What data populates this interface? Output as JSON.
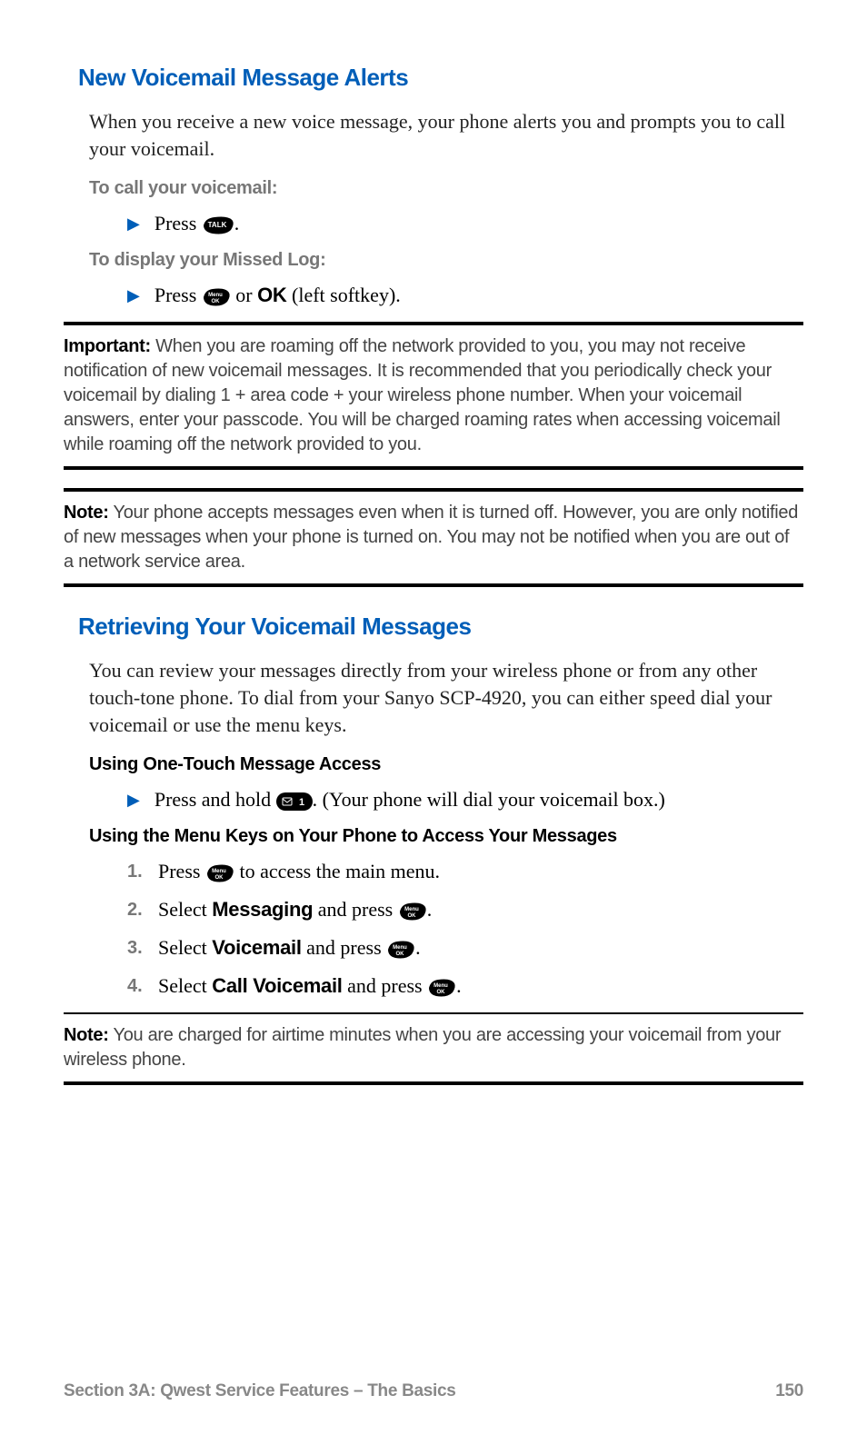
{
  "section1": {
    "heading": "New Voicemail Message Alerts",
    "intro": "When you receive a new voice message, your phone alerts you and prompts you to call your voicemail.",
    "instr1_label": "To call your voicemail:",
    "instr1_step_pre": "Press ",
    "instr1_step_post": ".",
    "instr2_label": "To display your Missed Log:",
    "instr2_step_pre": "Press ",
    "instr2_step_mid": " or ",
    "instr2_step_bold": "OK",
    "instr2_step_post": " (left softkey)."
  },
  "important": {
    "label": "Important:",
    "text": " When you are roaming off the network provided to you, you may not receive notification of new voicemail messages. It is recommended that you periodically check your voicemail by dialing 1 + area code + your wireless phone number. When your voicemail answers, enter your passcode. You will be charged roaming rates when accessing voicemail while roaming off the network provided to you."
  },
  "note1": {
    "label": "Note:",
    "text": " Your phone accepts messages even when it is turned off. However, you are only notified of new messages when your phone is turned on. You may not be notified when you are out of a network service area."
  },
  "section2": {
    "heading": "Retrieving Your Voicemail Messages",
    "intro": "You can review your messages directly from your wireless phone or from any other touch-tone phone. To dial from your Sanyo SCP-4920, you can either speed dial your voicemail or use the menu keys.",
    "sub1_label": "Using One-Touch Message Access",
    "sub1_step_pre": "Press and hold ",
    "sub1_step_post": ". (Your phone will dial your voicemail box.)",
    "sub2_label": "Using the Menu Keys on Your Phone to Access Your Messages",
    "steps": [
      {
        "n": "1.",
        "pre": "Press ",
        "bold": "",
        "post": " to access the main menu."
      },
      {
        "n": "2.",
        "pre": "Select ",
        "bold": "Messaging",
        "mid": " and press ",
        "post": "."
      },
      {
        "n": "3.",
        "pre": "Select ",
        "bold": "Voicemail",
        "mid": " and press ",
        "post": "."
      },
      {
        "n": "4.",
        "pre": "Select ",
        "bold": "Call Voicemail",
        "mid": " and press ",
        "post": "."
      }
    ]
  },
  "note2": {
    "label": "Note:",
    "text": " You are charged for airtime minutes when you are accessing your voicemail from your wireless phone."
  },
  "footer": {
    "left": "Section 3A: Qwest Service Features – The Basics",
    "right": "150"
  }
}
